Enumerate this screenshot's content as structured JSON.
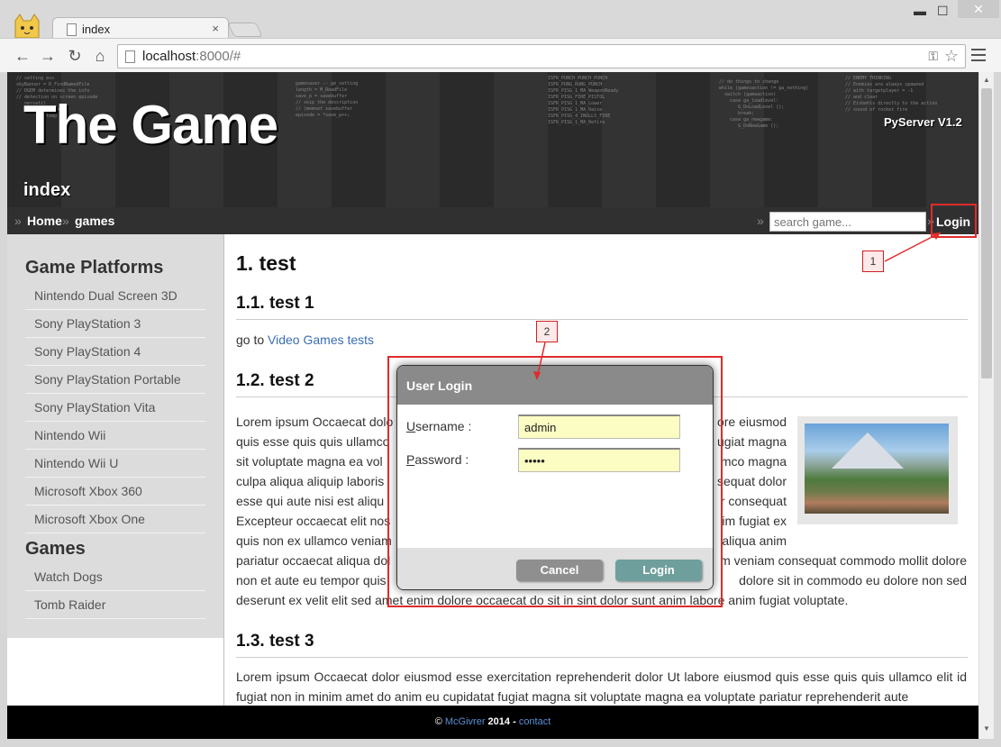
{
  "browser": {
    "tab_title": "index",
    "tab_close": "×",
    "url_host": "localhost",
    "url_rest": ":8000/#",
    "back": "←",
    "forward": "→",
    "reload": "↻",
    "home": "⌂",
    "star": "☆",
    "key": "⚿",
    "min": "▬",
    "max": "☐",
    "close": "✕"
  },
  "header": {
    "site_title": "The Game",
    "page_name": "index",
    "server": "PyServer V1.2"
  },
  "navbar": {
    "raquo": "»",
    "home": "Home",
    "games": "games",
    "search_placeholder": "search game...",
    "login": "Login"
  },
  "sidebar": {
    "platforms_heading": "Game Platforms",
    "platforms": [
      "Nintendo Dual Screen 3D",
      "Sony PlayStation 3",
      "Sony PlayStation 4",
      "Sony PlayStation Portable",
      "Sony PlayStation Vita",
      "Nintendo Wii",
      "Nintendo Wii U",
      "Microsoft Xbox 360",
      "Microsoft Xbox One"
    ],
    "games_heading": "Games",
    "games": [
      "Watch Dogs",
      "Tomb Raider"
    ]
  },
  "content": {
    "h1": "1. test",
    "s1_title": "1.1. test 1",
    "s1_text": "go to",
    "s1_link": "Video Games tests",
    "s2_title": "1.2. test 2",
    "s2_lines": [
      "Lorem ipsum Occaecat dolo",
      "quis esse quis quis ullamco",
      "sit voluptate magna ea vol",
      "culpa aliqua aliquip laboris",
      "esse qui aute nisi est aliqu",
      "Excepteur occaecat elit nos",
      "quis non ex ullamco veniam"
    ],
    "s2_right": [
      "ore eiusmod",
      "ugiat magna",
      "mco magna",
      "sequat dolor",
      "r consequat",
      "im fugiat ex",
      "aliqua anim"
    ],
    "s2_full_1": "pariatur occaecat aliqua dol",
    "s2_full_1b": "m veniam consequat commodo mollit dolore",
    "s2_full_2": "non et aute eu tempor quis",
    "s2_full_2b": "dolore sit in commodo eu dolore non sed",
    "s2_full_3": "deserunt ex velit elit sed amet enim dolore occaecat do sit in sint dolor sunt anim labore anim fugiat voluptate.",
    "s3_title": "1.3. test 3",
    "s3_text": "Lorem ipsum Occaecat dolor eiusmod esse exercitation reprehenderit dolor Ut labore eiusmod quis esse quis quis ullamco elit id fugiat non in minim amet do anim eu cupidatat fugiat magna sit voluptate magna ea voluptate pariatur reprehenderit aute"
  },
  "footer": {
    "copy": "©",
    "author": "McGivrer",
    "year": "2014 -",
    "contact": "contact"
  },
  "dialog": {
    "title": "User Login",
    "username_label_u": "U",
    "username_label_rest": "sername :",
    "username_value": "admin",
    "password_label_u": "P",
    "password_label_rest": "assword :",
    "password_value": "•••••",
    "cancel": "Cancel",
    "login": "Login"
  },
  "annotations": {
    "one": "1",
    "two": "2",
    "color": "#e02b2b"
  },
  "scroll": {
    "up": "▲",
    "down": "▼"
  }
}
